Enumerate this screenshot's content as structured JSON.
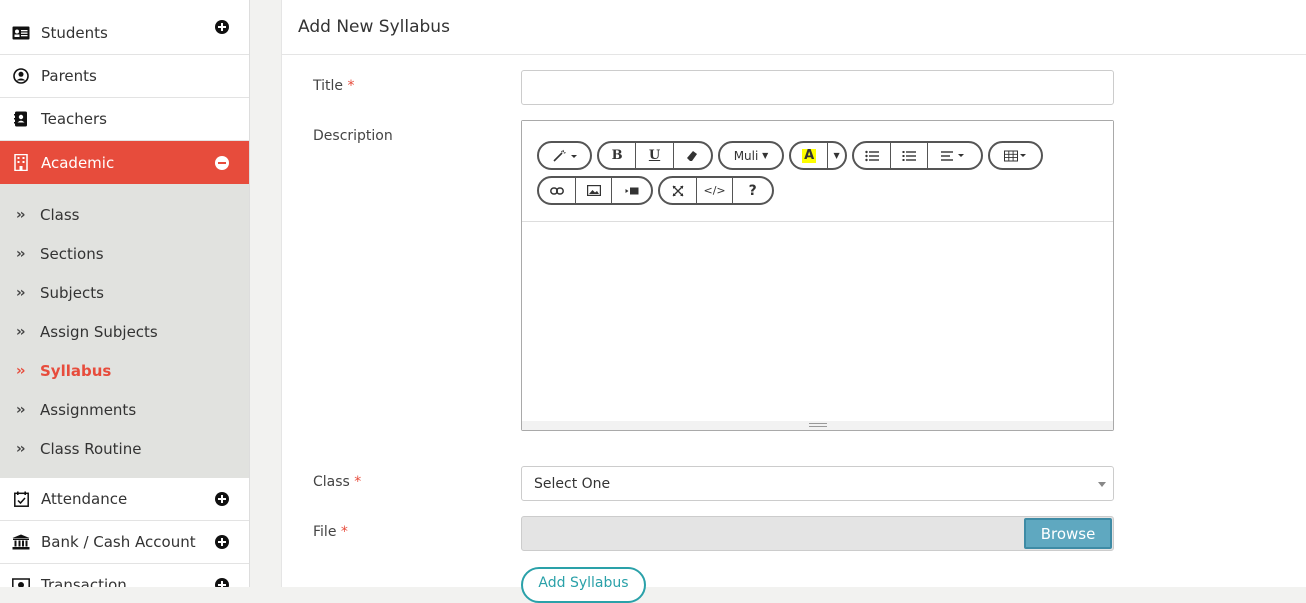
{
  "sidebar": {
    "items_top": [
      {
        "label": "Students",
        "icon": "id-card-icon"
      },
      {
        "label": "Parents",
        "icon": "user-circle-icon"
      },
      {
        "label": "Teachers",
        "icon": "address-book-icon"
      }
    ],
    "active": {
      "label": "Academic",
      "icon": "building-icon"
    },
    "submenu": [
      {
        "label": "Class"
      },
      {
        "label": "Sections"
      },
      {
        "label": "Subjects"
      },
      {
        "label": "Assign Subjects"
      },
      {
        "label": "Syllabus"
      },
      {
        "label": "Assignments"
      },
      {
        "label": "Class Routine"
      }
    ],
    "items_bottom": [
      {
        "label": "Attendance",
        "icon": "calendar-check-icon"
      },
      {
        "label": "Bank / Cash Account",
        "icon": "bank-icon"
      },
      {
        "label": "Transaction",
        "icon": "money-icon"
      }
    ]
  },
  "panel": {
    "title": "Add New Syllabus"
  },
  "form": {
    "title_label": "Title",
    "description_label": "Description",
    "class_label": "Class",
    "file_label": "File",
    "required_mark": "*",
    "class_selected": "Select One",
    "browse_label": "Browse",
    "submit_label": "Add Syllabus",
    "font_name": "Muli"
  },
  "colors": {
    "accent": "#e74c3c",
    "submit": "#2aa1a9",
    "browse": "#5fa8c0"
  }
}
